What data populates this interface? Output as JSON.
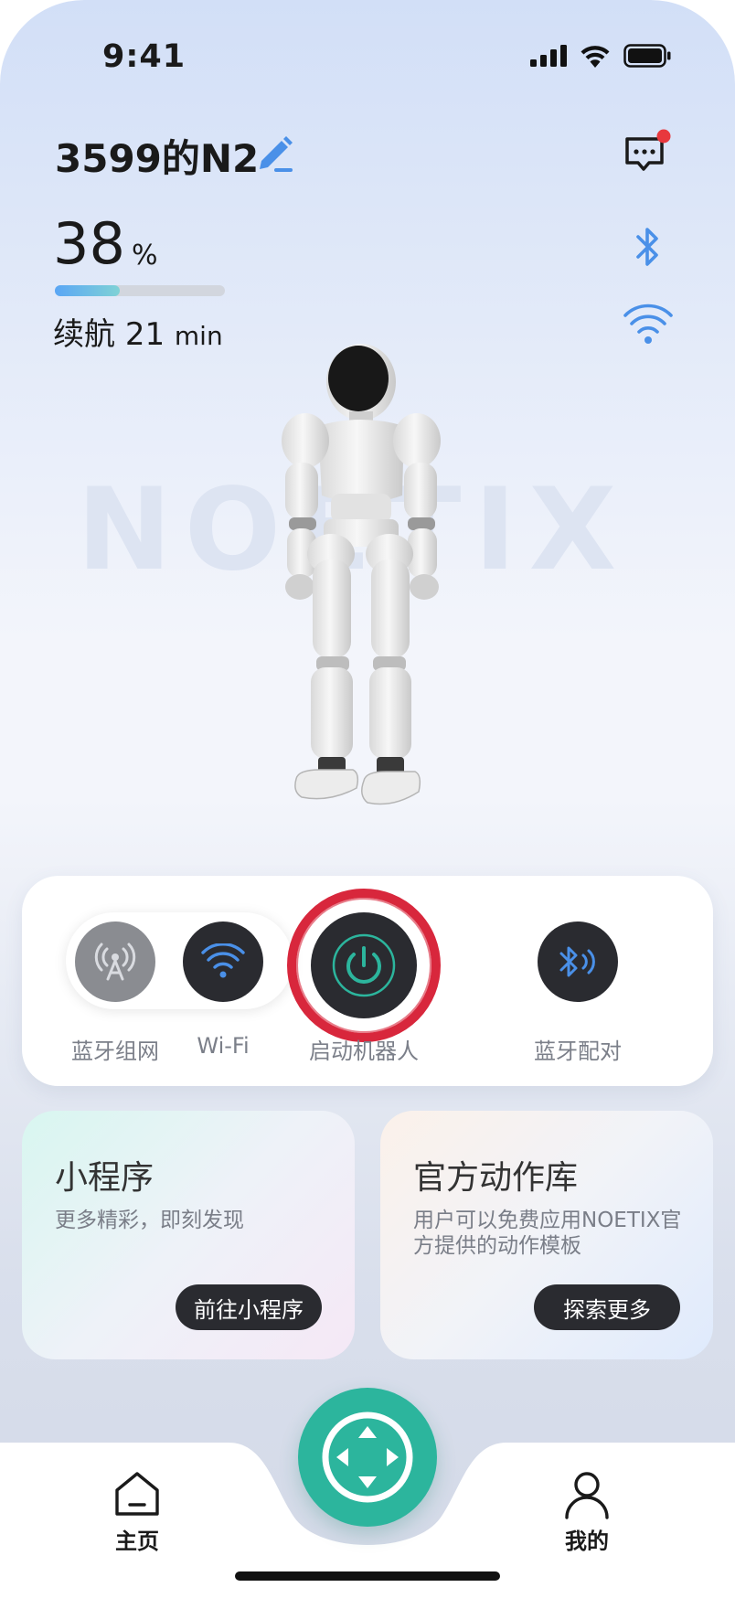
{
  "status_bar": {
    "time": "9:41"
  },
  "header": {
    "device_name": "3599的N2"
  },
  "battery": {
    "percent": "38",
    "unit": "%",
    "level_fraction": 0.38
  },
  "endurance": {
    "label": "续航",
    "value": "21",
    "unit": "min"
  },
  "watermark": "NOETIX",
  "controls": {
    "bt_network_label": "蓝牙组网",
    "wifi_label": "Wi-Fi",
    "start_robot_label": "启动机器人",
    "bt_pair_label": "蓝牙配对"
  },
  "mini_program": {
    "title": "小程序",
    "description": "更多精彩，即刻发现",
    "button": "前往小程序"
  },
  "action_library": {
    "title": "官方动作库",
    "description": "用户可以免费应用NOETIX官方提供的动作模板",
    "button": "探索更多"
  },
  "nav": {
    "home_label": "主页",
    "profile_label": "我的"
  },
  "colors": {
    "accent_green": "#2cb59d",
    "accent_blue": "#4a90e8",
    "dark_button": "#2a2b30",
    "notification_red": "#e8383d",
    "annotation_red": "#d8273c"
  }
}
